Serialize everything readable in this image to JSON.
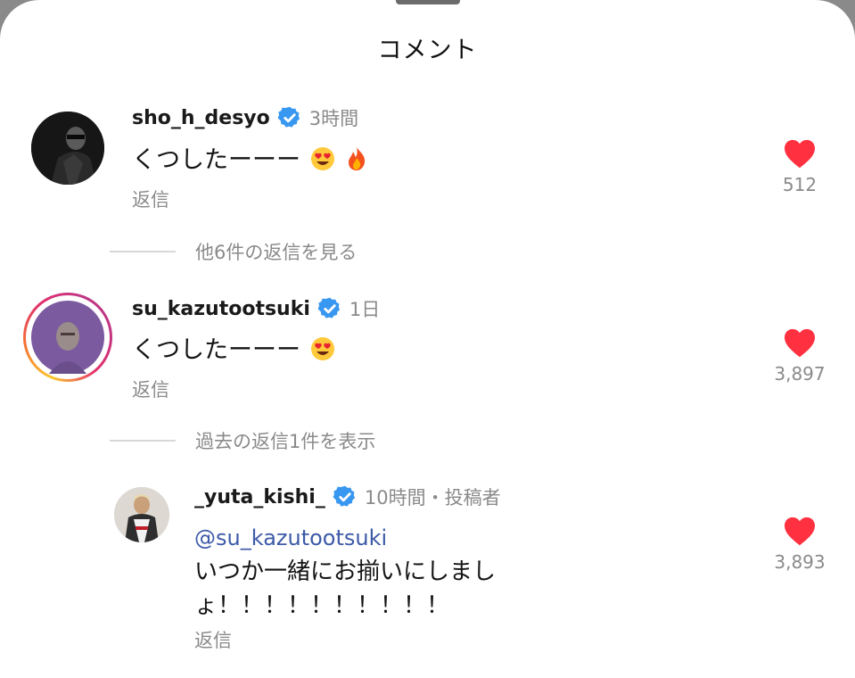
{
  "sheet": {
    "title": "コメント"
  },
  "comments": [
    {
      "username": "sho_h_desyo",
      "time": "3時間",
      "text": "くつしたーーー",
      "emojis": [
        "heart-eyes-emoji",
        "fire-emoji"
      ],
      "reply_label": "返信",
      "likes": "512",
      "more_replies": "他6件の返信を見る"
    },
    {
      "username": "su_kazutootsuki",
      "time": "1日",
      "text": "くつしたーーー",
      "emojis": [
        "heart-eyes-emoji"
      ],
      "reply_label": "返信",
      "likes": "3,897",
      "more_replies": "過去の返信1件を表示"
    }
  ],
  "reply": {
    "username": "_yuta_kishi_",
    "time": "10時間・投稿者",
    "mention": "@su_kazutootsuki",
    "line1": "いつか一緒にお揃いにしまし",
    "line2": "ょ！！！！！！！！！！",
    "likes": "3,893",
    "reply_label": "返信"
  },
  "colors": {
    "like_red": "#ff3040",
    "verified_blue": "#3897f0",
    "mention_blue": "#3d5aa8",
    "muted_gray": "#8a8a8a"
  }
}
